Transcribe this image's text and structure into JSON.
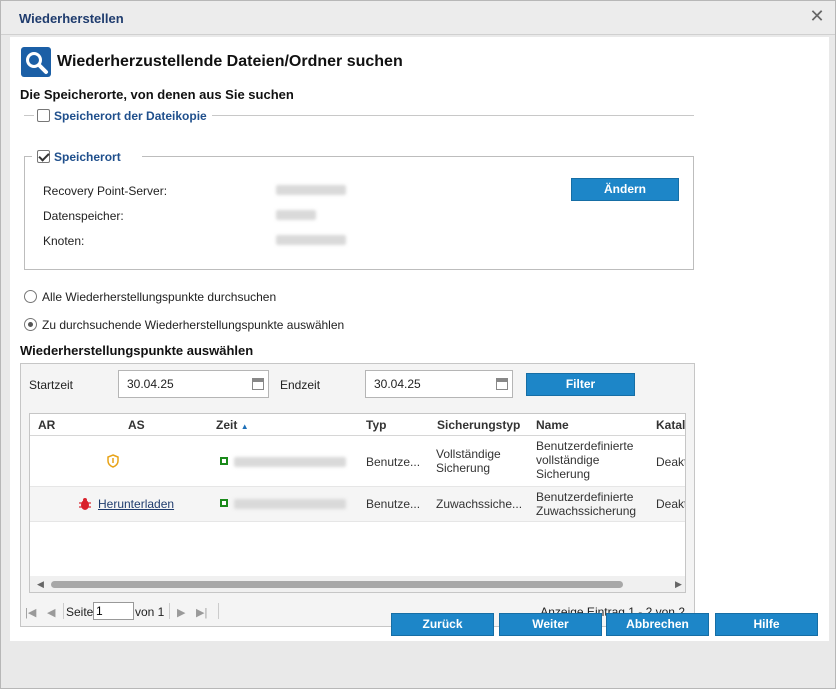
{
  "window": {
    "title": "Wiederherstellen"
  },
  "header": {
    "title": "Wiederherzustellende Dateien/Ordner suchen"
  },
  "locations": {
    "section_label": "Die Speicherorte, von denen aus Sie suchen",
    "file_copy_label": "Speicherort der Dateikopie",
    "file_copy_checked": false,
    "location_label": "Speicherort",
    "location_checked": true,
    "rps_label": "Recovery Point-Server:",
    "datastore_label": "Datenspeicher:",
    "node_label": "Knoten:",
    "change_button": "Ändern"
  },
  "search_mode": {
    "all_label": "Alle Wiederherstellungspunkte durchsuchen",
    "select_label": "Zu durchsuchende Wiederherstellungspunkte auswählen",
    "selected": "select"
  },
  "recovery": {
    "section_label": "Wiederherstellungspunkte auswählen",
    "start_label": "Startzeit",
    "start_value": "30.04.25",
    "end_label": "Endzeit",
    "end_value": "30.04.25",
    "filter_button": "Filter",
    "columns": [
      "AR",
      "AS",
      "Zeit",
      "Typ",
      "Sicherungstyp",
      "Name",
      "Katalo"
    ],
    "rows": [
      {
        "as_link": "",
        "typ": "Benutze...",
        "sicherungstyp": "Vollständige Sicherung",
        "name": "Benutzerdefinierte vollständige Sicherung",
        "katalog": "Deaktiv"
      },
      {
        "as_link": "Herunterladen",
        "typ": "Benutze...",
        "sicherungstyp": "Zuwachssiche...",
        "name": "Benutzerdefinierte Zuwachssicherung",
        "katalog": "Deaktiv"
      }
    ],
    "pager": {
      "page_label": "Seite",
      "page_value": "1",
      "of_label": "von 1",
      "summary": "Anzeige Eintrag 1 - 2 von 2"
    }
  },
  "footer": {
    "back": "Zurück",
    "next": "Weiter",
    "cancel": "Abbrechen",
    "help": "Hilfe"
  },
  "colors": {
    "accent": "#1d86c8",
    "title": "#1f3c6e",
    "link": "#1f4f8c"
  }
}
